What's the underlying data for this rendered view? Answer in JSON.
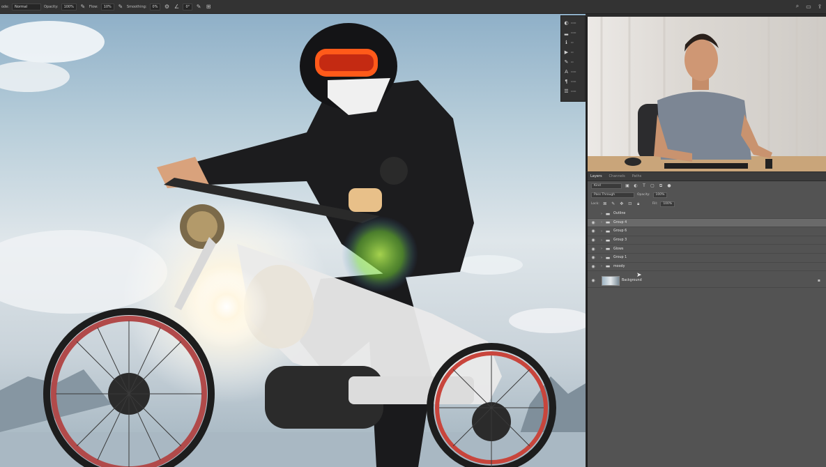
{
  "options_bar": {
    "mode_label": "ode:",
    "mode_value": "Normal",
    "opacity_label": "Opacity:",
    "opacity_value": "100%",
    "flow_label": "Flow:",
    "flow_value": "10%",
    "smoothing_label": "Smoothing:",
    "smoothing_value": "0%",
    "angle_value": "0°"
  },
  "layers_panel": {
    "tabs": [
      "Layers",
      "Channels",
      "Paths"
    ],
    "active_tab": "Layers",
    "filter_value": "Kind",
    "blend_mode": "Pass Through",
    "opacity_label": "Opacity:",
    "opacity_value": "100%",
    "lock_label": "Lock:",
    "fill_label": "Fill:",
    "fill_value": "100%",
    "layers": [
      {
        "name": "Outline",
        "type": "group",
        "visible": false,
        "selected": false
      },
      {
        "name": "Group 4",
        "type": "group",
        "visible": true,
        "selected": true
      },
      {
        "name": "Group 6",
        "type": "group",
        "visible": true,
        "selected": false
      },
      {
        "name": "Group 3",
        "type": "group",
        "visible": true,
        "selected": false
      },
      {
        "name": "Glows",
        "type": "group",
        "visible": true,
        "selected": false
      },
      {
        "name": "Group 1",
        "type": "group",
        "visible": true,
        "selected": false
      },
      {
        "name": "moody",
        "type": "group",
        "visible": true,
        "selected": false
      }
    ],
    "background_layer": "Background"
  },
  "colors": {
    "ui_dark": "#333333",
    "panel_bg": "#535353",
    "selected_row": "#6a6a6a"
  }
}
